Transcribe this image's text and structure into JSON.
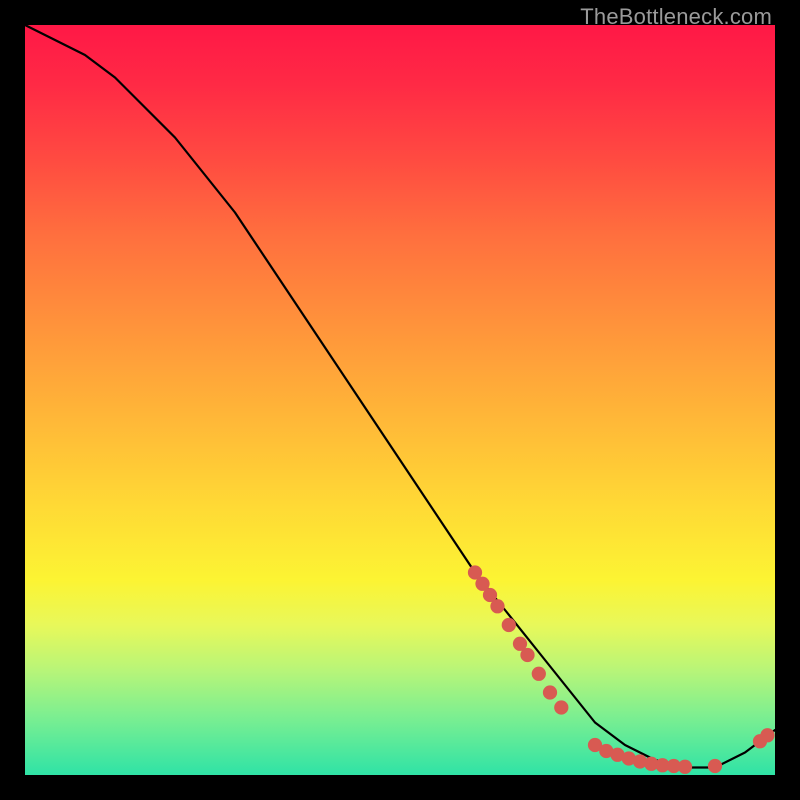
{
  "watermark": "TheBottleneck.com",
  "chart_data": {
    "type": "line",
    "title": "",
    "xlabel": "",
    "ylabel": "",
    "xlim": [
      0,
      100
    ],
    "ylim": [
      0,
      100
    ],
    "grid": false,
    "legend": false,
    "series": [
      {
        "name": "bottleneck-curve",
        "color": "#000000",
        "x": [
          0,
          4,
          8,
          12,
          16,
          20,
          24,
          28,
          32,
          36,
          40,
          44,
          48,
          52,
          56,
          60,
          64,
          68,
          72,
          76,
          80,
          84,
          88,
          92,
          96,
          100
        ],
        "y": [
          100,
          98,
          96,
          93,
          89,
          85,
          80,
          75,
          69,
          63,
          57,
          51,
          45,
          39,
          33,
          27,
          22,
          17,
          12,
          7,
          4,
          2,
          1,
          1,
          3,
          6
        ]
      }
    ],
    "markers": [
      {
        "name": "gpu-points",
        "shape": "circle",
        "color": "#d85a52",
        "radius_pct": 0.95,
        "points": [
          {
            "x": 60.0,
            "y": 27.0
          },
          {
            "x": 61.0,
            "y": 25.5
          },
          {
            "x": 62.0,
            "y": 24.0
          },
          {
            "x": 63.0,
            "y": 22.5
          },
          {
            "x": 64.5,
            "y": 20.0
          },
          {
            "x": 66.0,
            "y": 17.5
          },
          {
            "x": 67.0,
            "y": 16.0
          },
          {
            "x": 68.5,
            "y": 13.5
          },
          {
            "x": 70.0,
            "y": 11.0
          },
          {
            "x": 71.5,
            "y": 9.0
          },
          {
            "x": 76.0,
            "y": 4.0
          },
          {
            "x": 77.5,
            "y": 3.2
          },
          {
            "x": 79.0,
            "y": 2.7
          },
          {
            "x": 80.5,
            "y": 2.2
          },
          {
            "x": 82.0,
            "y": 1.8
          },
          {
            "x": 83.5,
            "y": 1.5
          },
          {
            "x": 85.0,
            "y": 1.3
          },
          {
            "x": 86.5,
            "y": 1.2
          },
          {
            "x": 88.0,
            "y": 1.1
          },
          {
            "x": 92.0,
            "y": 1.2
          },
          {
            "x": 98.0,
            "y": 4.5
          },
          {
            "x": 99.0,
            "y": 5.3
          }
        ]
      }
    ]
  }
}
